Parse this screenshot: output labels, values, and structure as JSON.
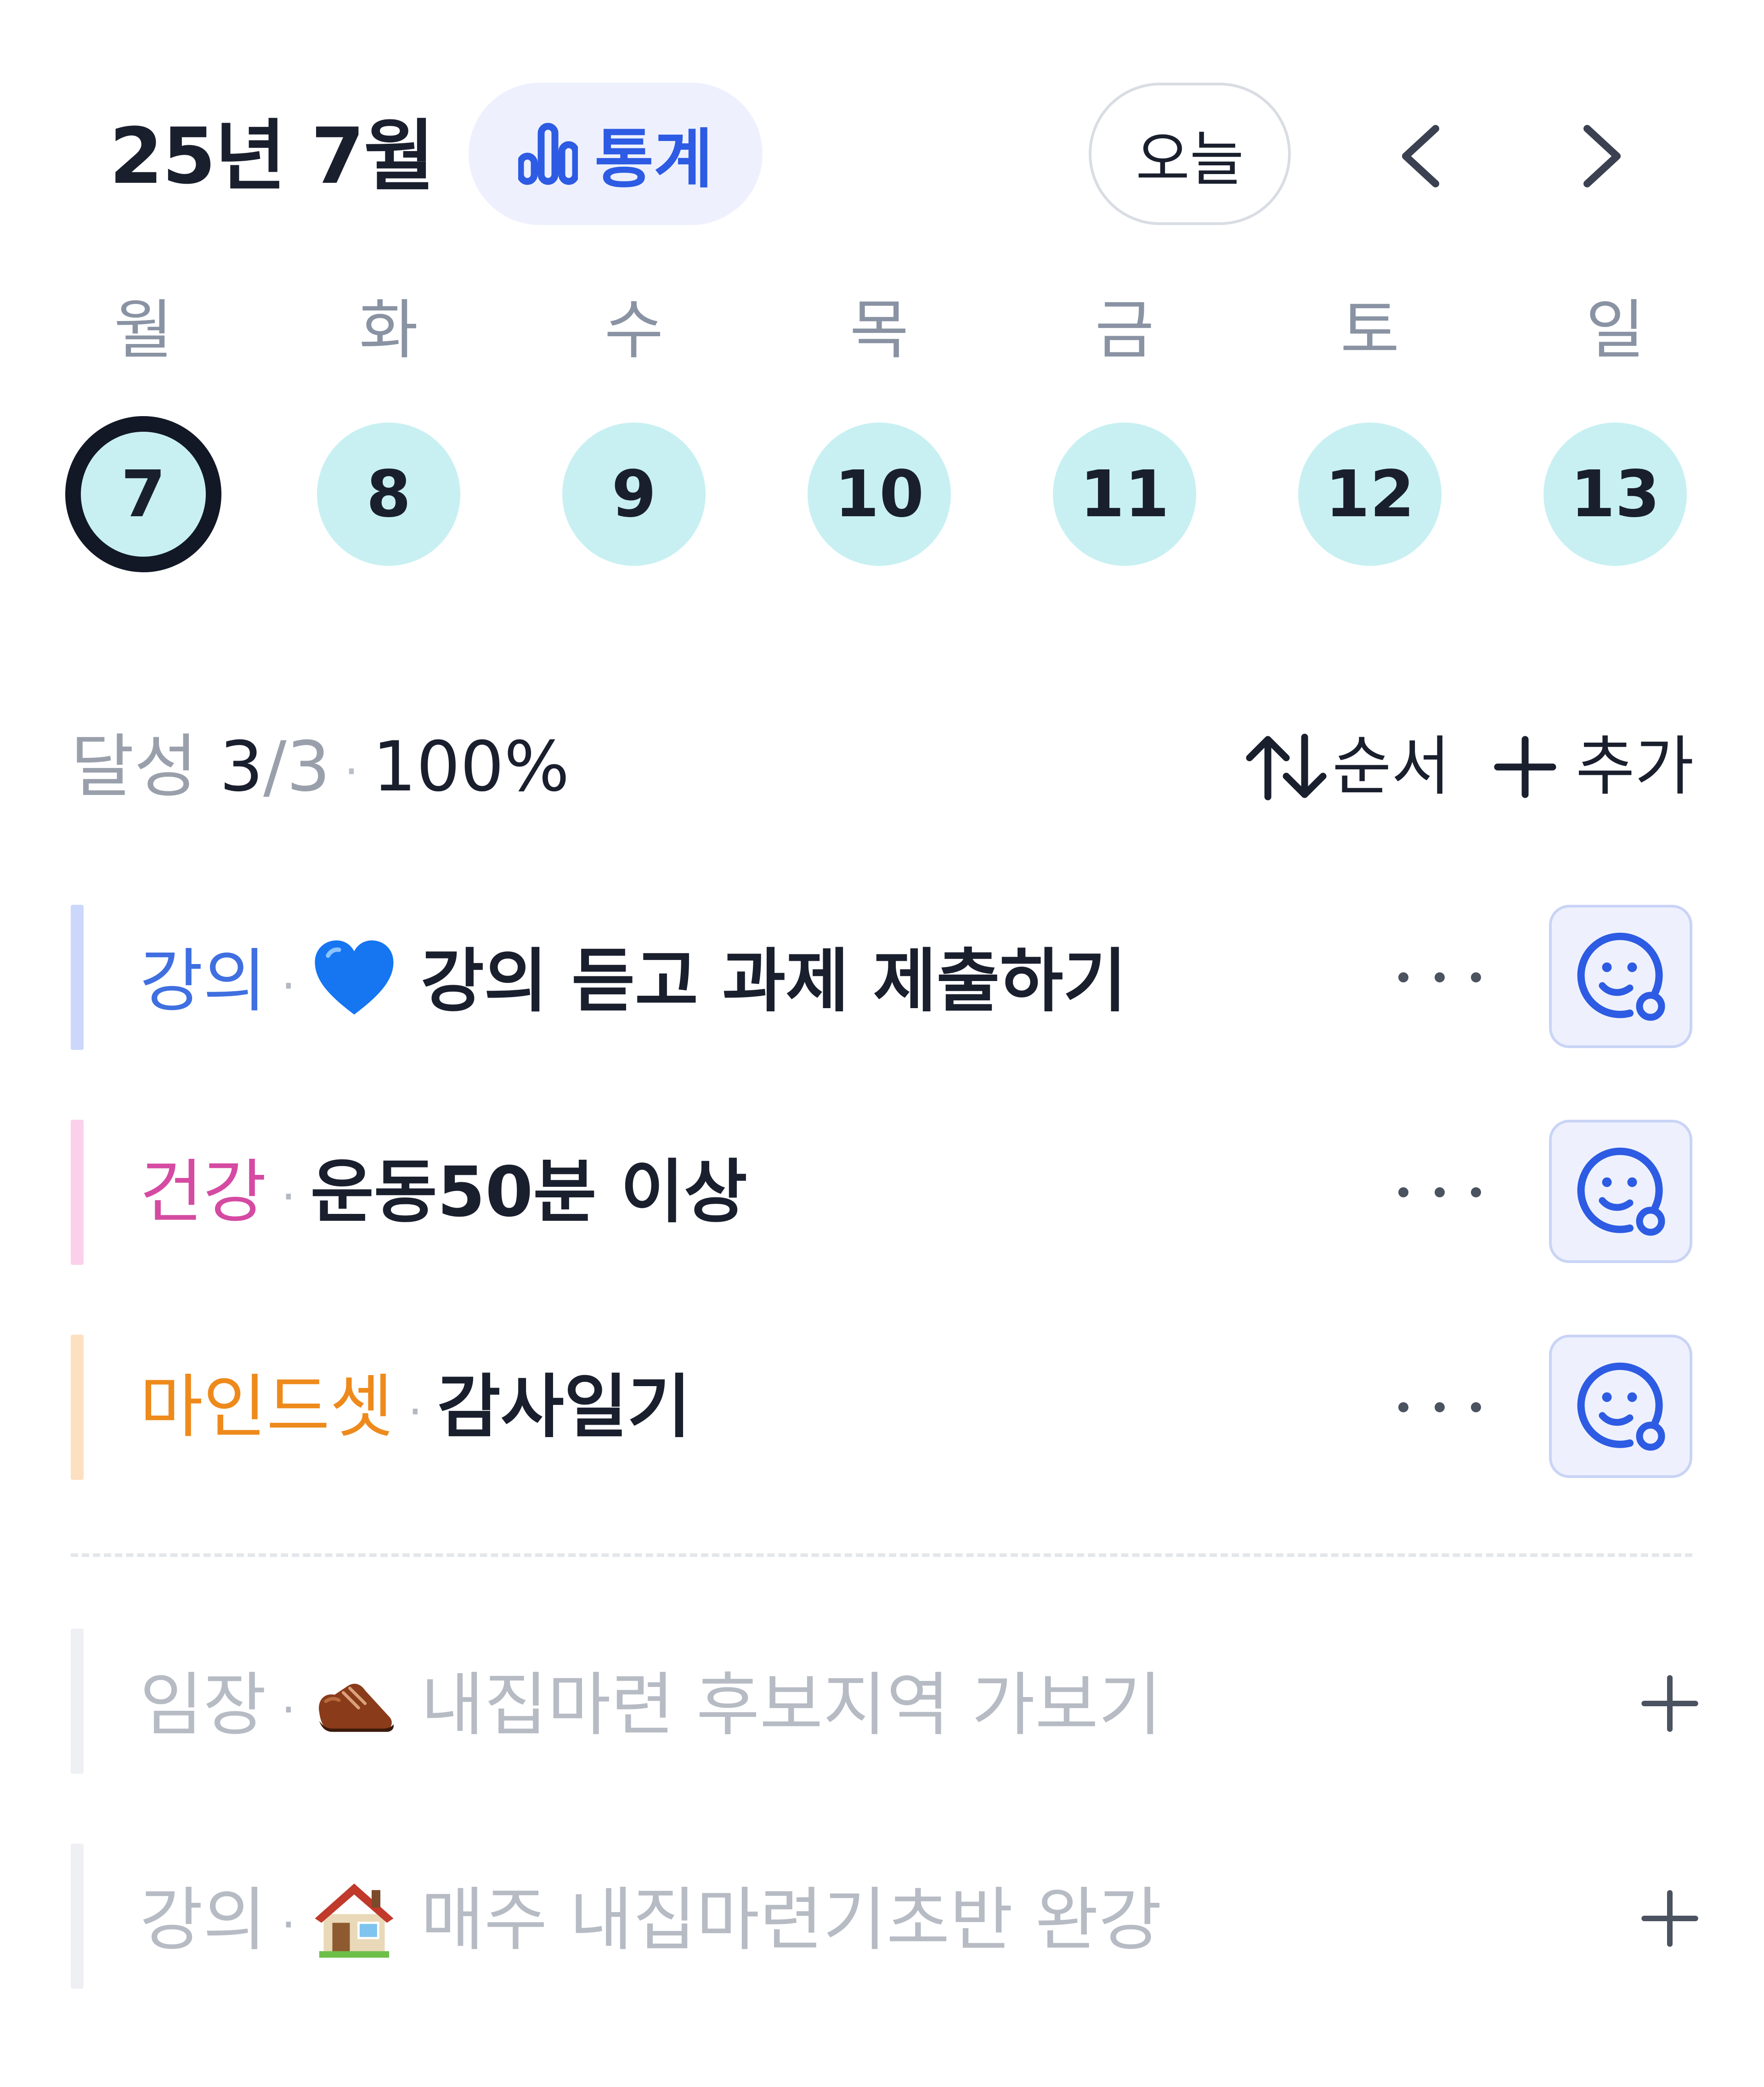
{
  "header": {
    "month_title": "25년 7월",
    "stats_label": "통계",
    "today_label": "오늘",
    "prev_icon": "chevron-left-icon",
    "next_icon": "chevron-right-icon"
  },
  "week": {
    "weekdays": [
      "월",
      "화",
      "수",
      "목",
      "금",
      "토",
      "일"
    ],
    "days": [
      "7",
      "8",
      "9",
      "10",
      "11",
      "12",
      "13"
    ],
    "selected_index": 0
  },
  "summary": {
    "label": "달성",
    "done": "3",
    "total": "/3",
    "separator": "·",
    "percent": "100%",
    "order_label": "순서",
    "add_label": "추가"
  },
  "habits": [
    {
      "category": "강의",
      "category_color": "#3f6fe0",
      "bar_color": "#cbd8fb",
      "emoji": "blue-heart",
      "title": "강의 듣고 과제 제출하기",
      "active": true
    },
    {
      "category": "건강",
      "category_color": "#d54aa2",
      "bar_color": "#fbd0ea",
      "emoji": "",
      "title": "운동50분 이상",
      "active": true
    },
    {
      "category": "마인드셋",
      "category_color": "#ee8a1c",
      "bar_color": "#fde0c0",
      "emoji": "",
      "title": "감사일기",
      "active": true
    },
    {
      "category": "임장",
      "bar_color": "#eef0f3",
      "emoji": "shoe",
      "title": "내집마련 후보지역 가보기",
      "active": false
    },
    {
      "category": "강의",
      "bar_color": "#eef0f3",
      "emoji": "house",
      "title": "매주 내집마련기초반 완강",
      "active": false
    }
  ],
  "sep": "·",
  "colors": {
    "accent": "#2d5be3",
    "day_bg": "#c8f0f2",
    "selected_ring": "#121826"
  }
}
